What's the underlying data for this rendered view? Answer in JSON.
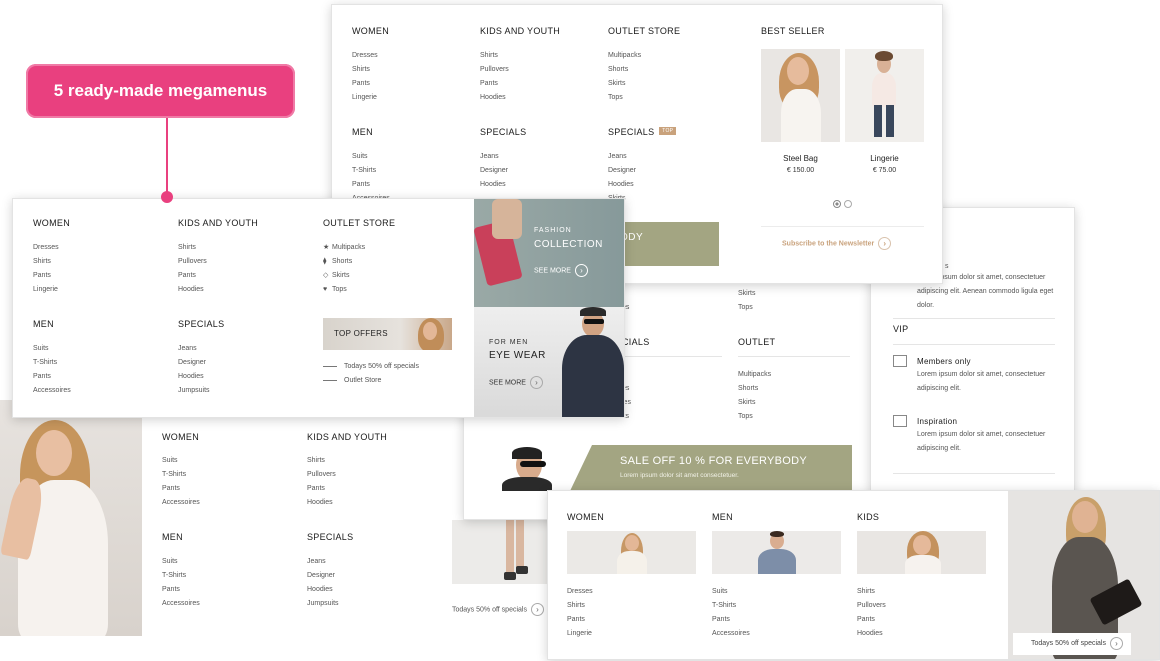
{
  "badge": {
    "label": "5 ready-made megamenus",
    "color": "#e9407f"
  },
  "panel_top": {
    "col1": {
      "title": "WOMEN",
      "links": [
        "Dresses",
        "Shirts",
        "Pants",
        "Lingerie"
      ]
    },
    "col2": {
      "title": "KIDS AND YOUTH",
      "links": [
        "Shirts",
        "Pullovers",
        "Pants",
        "Hoodies"
      ]
    },
    "col3": {
      "title": "OUTLET STORE",
      "links": [
        "Multipacks",
        "Shorts",
        "Skirts",
        "Tops"
      ]
    },
    "col4": {
      "title": "MEN",
      "links": [
        "Suits",
        "T-Shirts",
        "Pants",
        "Accessoires"
      ]
    },
    "col5": {
      "title": "SPECIALS",
      "links": [
        "Jeans",
        "Designer",
        "Hoodies"
      ]
    },
    "col6": {
      "title": "SPECIALS",
      "tag": "TOP",
      "links": [
        "Jeans",
        "Designer",
        "Hoodies",
        "Skirts"
      ]
    },
    "bestseller": {
      "title": "BEST SELLER",
      "items": [
        {
          "name": "Steel Bag",
          "price": "€ 150.00"
        },
        {
          "name": "Lingerie",
          "price": "€ 75.00"
        }
      ]
    },
    "banner_text": "ODY",
    "subscribe": "Subscribe to the Newsletter"
  },
  "panel_main": {
    "col1": {
      "title": "WOMEN",
      "links": [
        "Dresses",
        "Shirts",
        "Pants",
        "Lingerie"
      ]
    },
    "col2": {
      "title": "KIDS AND YOUTH",
      "links": [
        "Shirts",
        "Pullovers",
        "Pants",
        "Hoodies"
      ]
    },
    "col3": {
      "title": "OUTLET STORE",
      "links": [
        "Multipacks",
        "Shorts",
        "Skirts",
        "Tops"
      ]
    },
    "col4": {
      "title": "MEN",
      "links": [
        "Suits",
        "T-Shirts",
        "Pants",
        "Accessoires"
      ]
    },
    "col5": {
      "title": "SPECIALS",
      "links": [
        "Jeans",
        "Designer",
        "Hoodies",
        "Jumpsuits"
      ]
    },
    "top_offers": "TOP OFFERS",
    "offer_links": [
      "Todays 50% off specials",
      "Outlet Store"
    ],
    "promo1": {
      "kicker": "FASHION",
      "title": "COLLECTION",
      "cta": "SEE MORE"
    },
    "promo2": {
      "kicker": "FOR MEN",
      "title": "EYE WEAR",
      "cta": "SEE MORE"
    }
  },
  "panel_mid": {
    "frag_links_a": [
      "Skirts",
      "Tops"
    ],
    "frag_links_b": [
      "Skirts",
      "Tops"
    ],
    "specials_frag": "CIALS",
    "outlet": {
      "title": "OUTLET",
      "links": [
        "Multipacks",
        "Shorts",
        "Skirts",
        "Tops"
      ]
    },
    "sale": {
      "title": "SALE OFF 10 % FOR EVERYBODY",
      "sub": "Lorem ipsum dolor sit amet consectetuer."
    }
  },
  "panel_right": {
    "frag_label": "s",
    "lorem1": "Lorem ipsum dolor sit amet, consectetuer adipiscing elit. Aenean commodo ligula eget dolor.",
    "vip": "VIP",
    "items": [
      {
        "title": "Members only",
        "text": "Lorem ipsum dolor sit amet, consectetuer adipiscing elit."
      },
      {
        "title": "Inspiration",
        "text": "Lorem ipsum dolor sit amet, consectetuer adipiscing elit."
      }
    ]
  },
  "panel_bottomleft": {
    "col1": {
      "title": "WOMEN",
      "links": [
        "Suits",
        "T-Shirts",
        "Pants",
        "Accessoires"
      ]
    },
    "col2": {
      "title": "KIDS AND YOUTH",
      "links": [
        "Shirts",
        "Pullovers",
        "Pants",
        "Hoodies"
      ]
    },
    "col3": {
      "title": "MEN",
      "links": [
        "Suits",
        "T-Shirts",
        "Pants",
        "Accessoires"
      ]
    },
    "col4": {
      "title": "SPECIALS",
      "links": [
        "Jeans",
        "Designer",
        "Hoodies",
        "Jumpsuits"
      ]
    },
    "offer": "Todays 50% off specials"
  },
  "panel_bottomright": {
    "col1": {
      "title": "WOMEN",
      "links": [
        "Dresses",
        "Shirts",
        "Pants",
        "Lingerie"
      ]
    },
    "col2": {
      "title": "MEN",
      "links": [
        "Suits",
        "T-Shirts",
        "Pants",
        "Accessoires"
      ]
    },
    "col3": {
      "title": "KIDS",
      "links": [
        "Shirts",
        "Pullovers",
        "Pants",
        "Hoodies"
      ]
    },
    "offer": "Todays 50% off specials"
  },
  "colors": {
    "accent": "#e9407f",
    "olive": "#a3a582",
    "gold": "#c9a27c",
    "slate": "#8c9f9c"
  }
}
